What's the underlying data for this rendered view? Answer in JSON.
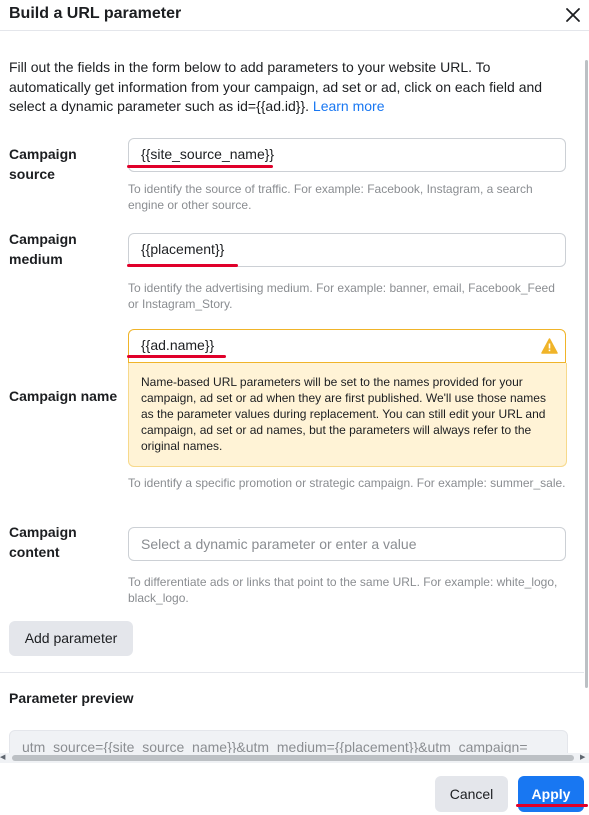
{
  "dialog": {
    "title": "Build a URL parameter",
    "intro_text": "Fill out the fields in the form below to add parameters to your website URL. To automatically get information from your campaign, ad set or ad, click on each field and select a dynamic parameter such as id={{ad.id}}.",
    "learn_more": "Learn more"
  },
  "fields": {
    "source": {
      "label": "Campaign source",
      "value": "{{site_source_name}}",
      "help": "To identify the source of traffic. For example: Facebook, Instagram, a search engine or other source."
    },
    "medium": {
      "label_line1": "Campaign",
      "label_line2": "medium",
      "value": "{{placement}}",
      "help": "To identify the advertising medium. For example: banner, email, Facebook_Feed or Instagram_Story."
    },
    "name": {
      "label": "Campaign name",
      "value": "{{ad.name}}",
      "warning": "Name-based URL parameters will be set to the names provided for your campaign, ad set or ad when they are first published. We'll use those names as the parameter values during replacement. You can still edit your URL and campaign, ad set or ad names, but the parameters will always refer to the original names.",
      "help": "To identify a specific promotion or strategic campaign. For example: summer_sale."
    },
    "content": {
      "label_line1": "Campaign",
      "label_line2": "content",
      "placeholder": "Select a dynamic parameter or enter a value",
      "help": "To differentiate ads or links that point to the same URL. For example: white_logo, black_logo."
    }
  },
  "add_parameter": "Add parameter",
  "preview": {
    "title": "Parameter preview",
    "text": "utm_source={{site_source_name}}&utm_medium={{placement}}&utm_campaign="
  },
  "footer": {
    "cancel": "Cancel",
    "apply": "Apply"
  },
  "colors": {
    "accent": "#1877f2",
    "warning": "#f0b429",
    "warning_bg": "#fff3d6",
    "annotation": "#e0002a"
  }
}
